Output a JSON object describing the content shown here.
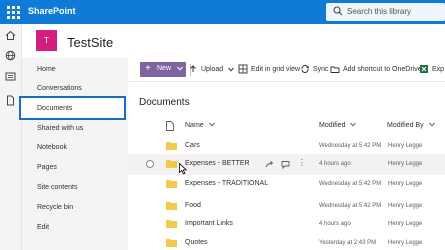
{
  "suite": {
    "app_name": "SharePoint",
    "search_placeholder": "Search this library"
  },
  "site": {
    "logo_letter": "T",
    "title": "TestSite"
  },
  "nav": {
    "items": [
      {
        "label": "Home"
      },
      {
        "label": "Conversations"
      },
      {
        "label": "Documents"
      },
      {
        "label": "Shared with us"
      },
      {
        "label": "Notebook"
      },
      {
        "label": "Pages"
      },
      {
        "label": "Site contents"
      },
      {
        "label": "Recycle bin"
      },
      {
        "label": "Edit"
      }
    ],
    "selected": "Documents"
  },
  "commandbar": {
    "new_label": "New",
    "upload_label": "Upload",
    "grid_label": "Edit in grid view",
    "sync_label": "Sync",
    "shortcut_label": "Add shortcut to OneDrive",
    "export_label": "Exp"
  },
  "library": {
    "title": "Documents",
    "columns": {
      "name": "Name",
      "modified": "Modified",
      "modified_by": "Modified By"
    },
    "rows": [
      {
        "name": "Cars",
        "modified": "Wednesday at 5:42 PM",
        "modified_by": "Henry Legge"
      },
      {
        "name": "Expenses - BETTER",
        "modified": "4 hours ago",
        "modified_by": "Henry Legge"
      },
      {
        "name": "Expenses - TRADITIONAL",
        "modified": "Wednesday at 5:42 PM",
        "modified_by": "Henry Legge"
      },
      {
        "name": "Food",
        "modified": "Wednesday at 5:42 PM",
        "modified_by": "Henry Legge"
      },
      {
        "name": "Important Links",
        "modified": "4 hours ago",
        "modified_by": "Henry Legge"
      },
      {
        "name": "Quotes",
        "modified": "Yesterday at 2:43 PM",
        "modified_by": "Henry Legge"
      }
    ]
  },
  "colors": {
    "suite_bar": "#0f7bd6",
    "new_button": "#8064a2",
    "site_logo": "#d31d7f",
    "folder": "#f2c94c",
    "selection_border": "#1a6cbf"
  }
}
